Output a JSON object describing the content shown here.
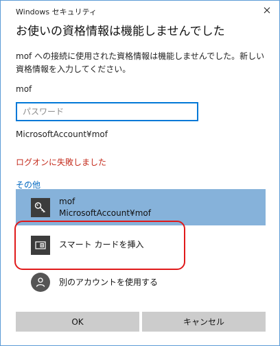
{
  "window": {
    "title": "Windows セキュリティ",
    "close_icon": "close-icon"
  },
  "dialog": {
    "heading": "お使いの資格情報は機能しませんでした",
    "message": "mof への接続に使用された資格情報は機能しませんでした。新しい資格情報を入力してください。",
    "username": "mof",
    "password_placeholder": "パスワード",
    "password_value": "",
    "account_id": "MicrosoftAccount¥mof",
    "error": "ログオンに失敗しました",
    "other_link": "その他"
  },
  "options": [
    {
      "icon": "key-icon",
      "title": "mof",
      "subtitle": "MicrosoftAccount¥mof",
      "selected": true
    },
    {
      "icon": "smart-card-icon",
      "title": "スマート カードを挿入",
      "subtitle": "",
      "selected": false
    },
    {
      "icon": "user-icon",
      "title": "別のアカウントを使用する",
      "subtitle": "",
      "selected": false
    }
  ],
  "buttons": {
    "ok": "OK",
    "cancel": "キャンセル"
  },
  "colors": {
    "accent": "#0078d7",
    "error": "#c42b1c",
    "selection": "#86b2da",
    "highlight_ring": "#e0191a"
  }
}
